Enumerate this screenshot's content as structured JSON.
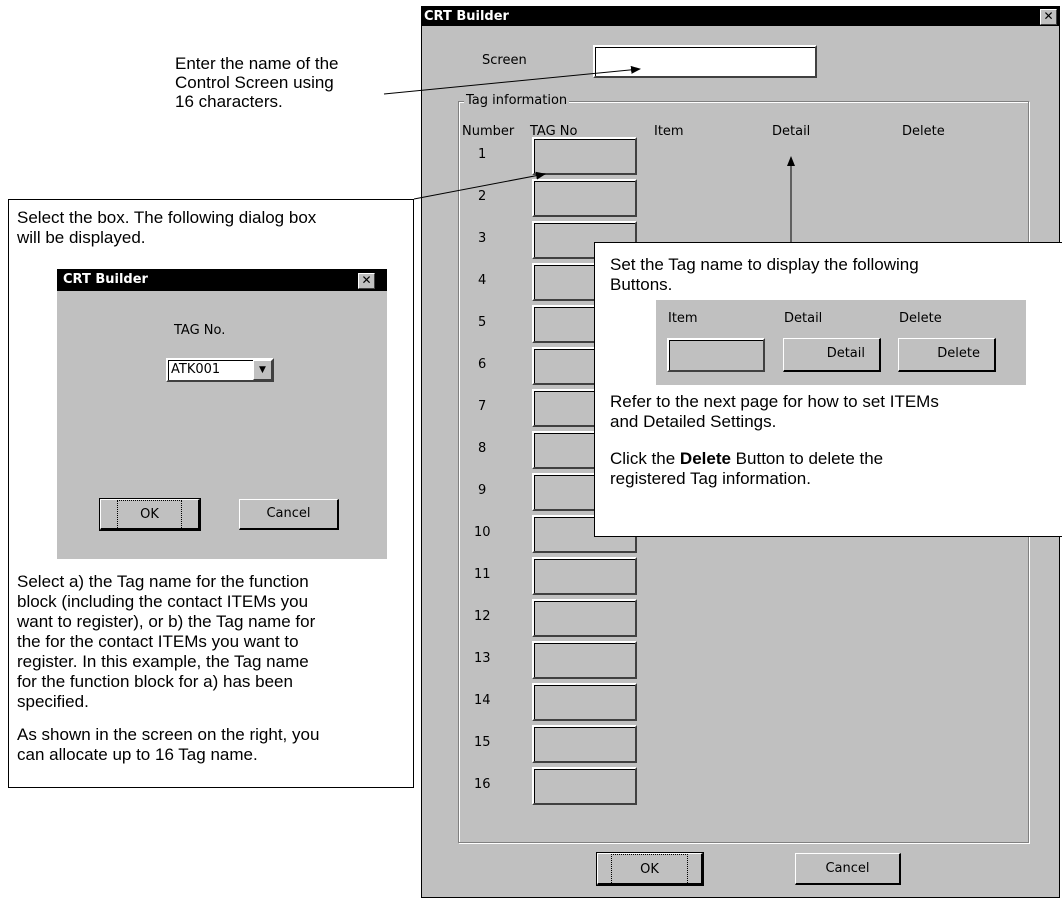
{
  "main_dialog": {
    "title": "CRT Builder",
    "close_glyph": "✕",
    "screen_label": "Screen",
    "screen_value": "",
    "group_label": "Tag information",
    "col_number": "Number",
    "col_tag": "TAG No",
    "col_item": "Item",
    "col_detail": "Detail",
    "col_delete": "Delete",
    "rows": [
      "1",
      "2",
      "3",
      "4",
      "5",
      "6",
      "7",
      "8",
      "9",
      "10",
      "11",
      "12",
      "13",
      "14",
      "15",
      "16"
    ],
    "ok_label": "OK",
    "cancel_label": "Cancel"
  },
  "annotation_screen": {
    "lines": [
      "Enter the name of the",
      "Control Screen using",
      "16 characters."
    ]
  },
  "callout_left": {
    "intro_lines": [
      "Select the box. The following dialog box",
      "will be displayed."
    ],
    "body_lines": [
      "Select a) the Tag name for the function",
      "block (including the contact ITEMs you",
      "want to register), or b) the Tag name for",
      "the for the contact ITEMs you want to",
      "register. In this example, the Tag name",
      "for the function block for a) has been",
      "specified."
    ],
    "footer_lines": [
      "As shown in the screen on the right, you",
      "can allocate up to 16 Tag name."
    ]
  },
  "small_dialog": {
    "title": "CRT Builder",
    "close_glyph": "✕",
    "tag_label": "TAG No.",
    "tag_value": "ATK001",
    "dropdown_glyph": "▼",
    "ok_label": "OK",
    "cancel_label": "Cancel"
  },
  "callout_right": {
    "intro_lines": [
      "Set the Tag name to display the following",
      "Buttons."
    ],
    "strip": {
      "item_label": "Item",
      "detail_label": "Detail",
      "delete_label": "Delete",
      "detail_button": "Detail",
      "delete_button": "Delete"
    },
    "refer_lines": [
      "Refer to the next page for how to set ITEMs",
      "and Detailed Settings."
    ],
    "click_prefix": "Click the ",
    "click_bold": "Delete",
    "click_suffix": " Button to delete the",
    "click_line2": "registered Tag information."
  }
}
